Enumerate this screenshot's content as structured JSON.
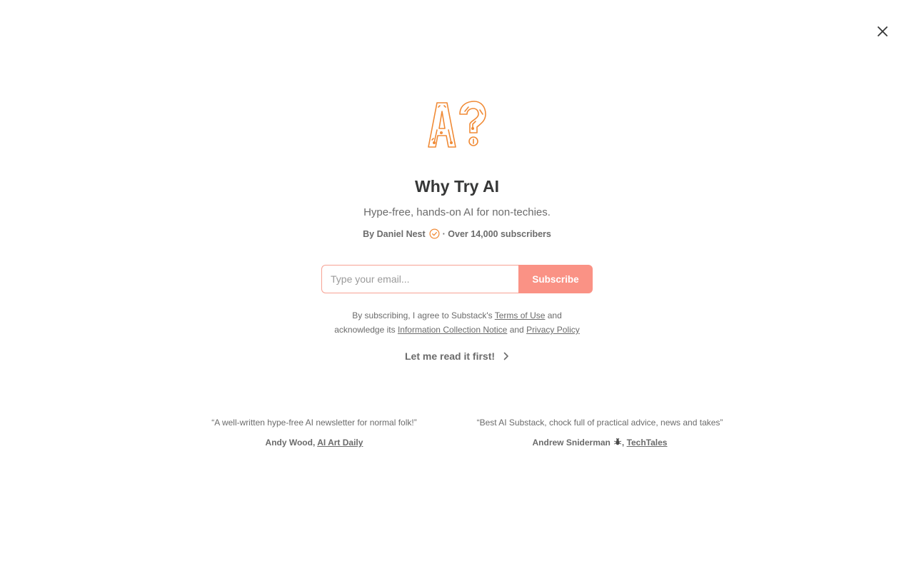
{
  "close": {
    "icon": "close-icon"
  },
  "logo": {
    "icon": "ai-question-logo",
    "accent": "#f08a35"
  },
  "publication": {
    "title": "Why Try AI",
    "tagline": "Hype-free, hands-on AI for non-techies.",
    "byline_prefix": "By Daniel Nest",
    "byline_suffix": "· Over 14,000 subscribers",
    "verified_icon": "verified-check-icon"
  },
  "form": {
    "email_placeholder": "Type your email...",
    "subscribe_label": "Subscribe",
    "button_color": "#fa9285"
  },
  "legal": {
    "text1": "By subscribing, I agree to Substack's ",
    "terms_link": "Terms of Use",
    "text2": " and",
    "text3": "acknowledge its ",
    "info_link": "Information Collection Notice",
    "text4": " and ",
    "privacy_link": "Privacy Policy"
  },
  "read_first": {
    "label": "Let me read it first!",
    "icon": "chevron-right-icon"
  },
  "testimonials": [
    {
      "quote": "“A well-written hype-free AI newsletter for normal folk!”",
      "author": "Andy Wood,",
      "publication": "AI Art Daily"
    },
    {
      "quote": "“Best AI Substack, chock full of practical advice, news and takes”",
      "author": "Andrew Sniderman",
      "author_suffix": ",",
      "publication": "TechTales",
      "icon": "bug-icon"
    }
  ]
}
